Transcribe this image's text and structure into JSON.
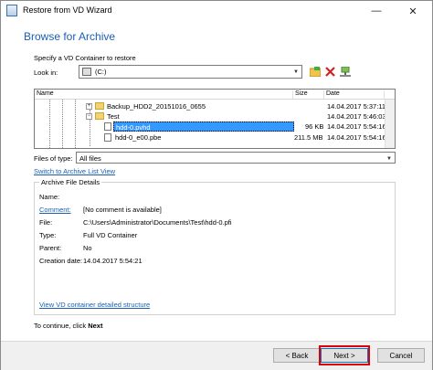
{
  "window": {
    "title": "Restore from VD Wizard",
    "minimize": "—",
    "close": "✕"
  },
  "heading": "Browse for Archive",
  "instruction": "Specify a VD Container to restore",
  "look_in": {
    "label": "Look in:",
    "value": "(C:)",
    "drive_icon": "drive-icon"
  },
  "toolbar": {
    "new_folder_icon": "new-folder-icon",
    "delete_icon": "delete-icon",
    "network_icon": "network-icon"
  },
  "file_list": {
    "columns": [
      "Name",
      "Size",
      "Date"
    ],
    "rows": [
      {
        "name": "Backup_HDD2_20151016_0655",
        "size": "",
        "date": "14.04.2017 5:37:11",
        "type": "folder"
      },
      {
        "name": "Test",
        "size": "",
        "date": "14.04.2017 5:46:03",
        "type": "folder"
      },
      {
        "name": "hdd-0.pvhd",
        "size": "96 KB",
        "date": "14.04.2017 5:54:16",
        "type": "file",
        "selected": true
      },
      {
        "name": "hdd-0_e00.pbe",
        "size": "211.5 MB",
        "date": "14.04.2017 5:54:16",
        "type": "file"
      }
    ]
  },
  "files_of_type": {
    "label": "Files of type:",
    "value": "All files"
  },
  "switch_link": "Switch to Archive List View",
  "details": {
    "legend": "Archive File Details",
    "name_label": "Name:",
    "name_value": "",
    "comment_label": "Comment:",
    "comment_value": "[No comment is available]",
    "file_label": "File:",
    "file_value": "C:\\Users\\Administrator\\Documents\\Test\\hdd-0.pfi",
    "type_label": "Type:",
    "type_value": "Full VD Container",
    "parent_label": "Parent:",
    "parent_value": "No",
    "created_label": "Creation date:",
    "created_value": "14.04.2017 5:54:21",
    "structure_link": "View VD container detailed structure"
  },
  "continue_text": {
    "prefix": "To continue, click ",
    "bold": "Next"
  },
  "buttons": {
    "back": "< Back",
    "next": "Next >",
    "cancel": "Cancel"
  },
  "colors": {
    "accent": "#1a5fb4",
    "selection": "#3399ff",
    "highlight": "#e00000"
  }
}
